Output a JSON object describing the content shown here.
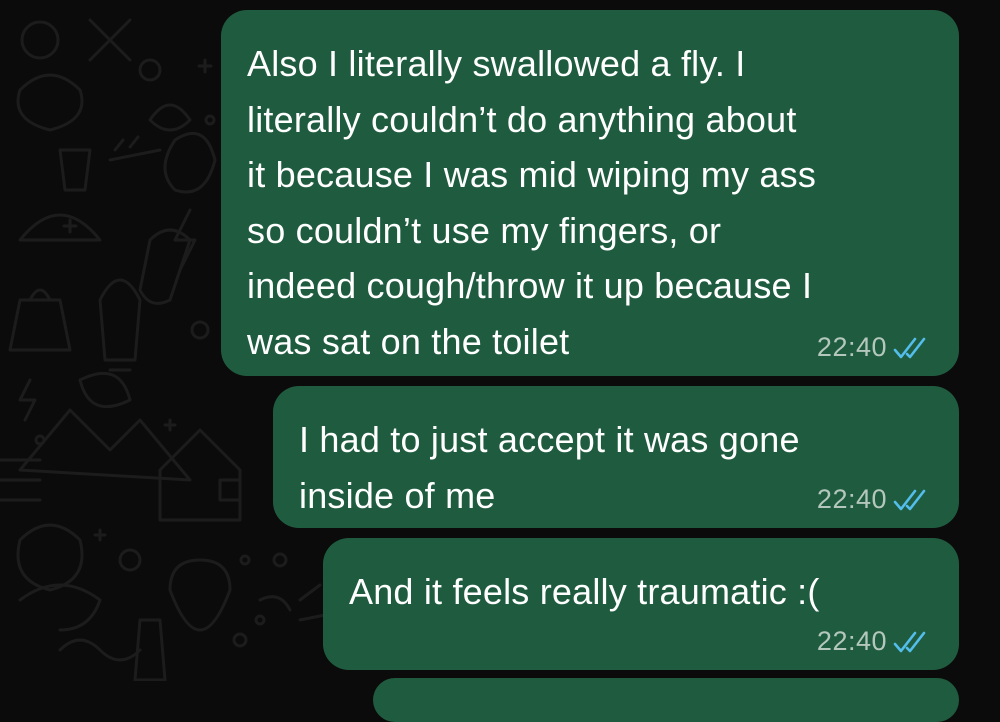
{
  "messages": [
    {
      "text": "Also I literally swallowed a fly. I\nliterally couldn’t do anything about\nit because I was mid wiping my ass\nso couldn’t use my fingers, or\nindeed cough/throw it up because I\nwas sat on the toilet",
      "time": "22:40",
      "status": "read"
    },
    {
      "text": "I had to just accept it was gone\ninside of me",
      "time": "22:40",
      "status": "read"
    },
    {
      "text": "And it feels really traumatic :(",
      "time": "22:40",
      "status": "read"
    }
  ],
  "colors": {
    "background": "#0b0b0b",
    "outgoing_bubble": "#1f5c3f",
    "message_text": "#ffffff",
    "timestamp": "#b4c7bc",
    "read_ticks": "#53bdeb",
    "wallpaper_doodles": "#1c1c1c"
  },
  "icons": {
    "read_receipt": "double-check-icon",
    "wallpaper": "chat-doodle-wallpaper"
  }
}
